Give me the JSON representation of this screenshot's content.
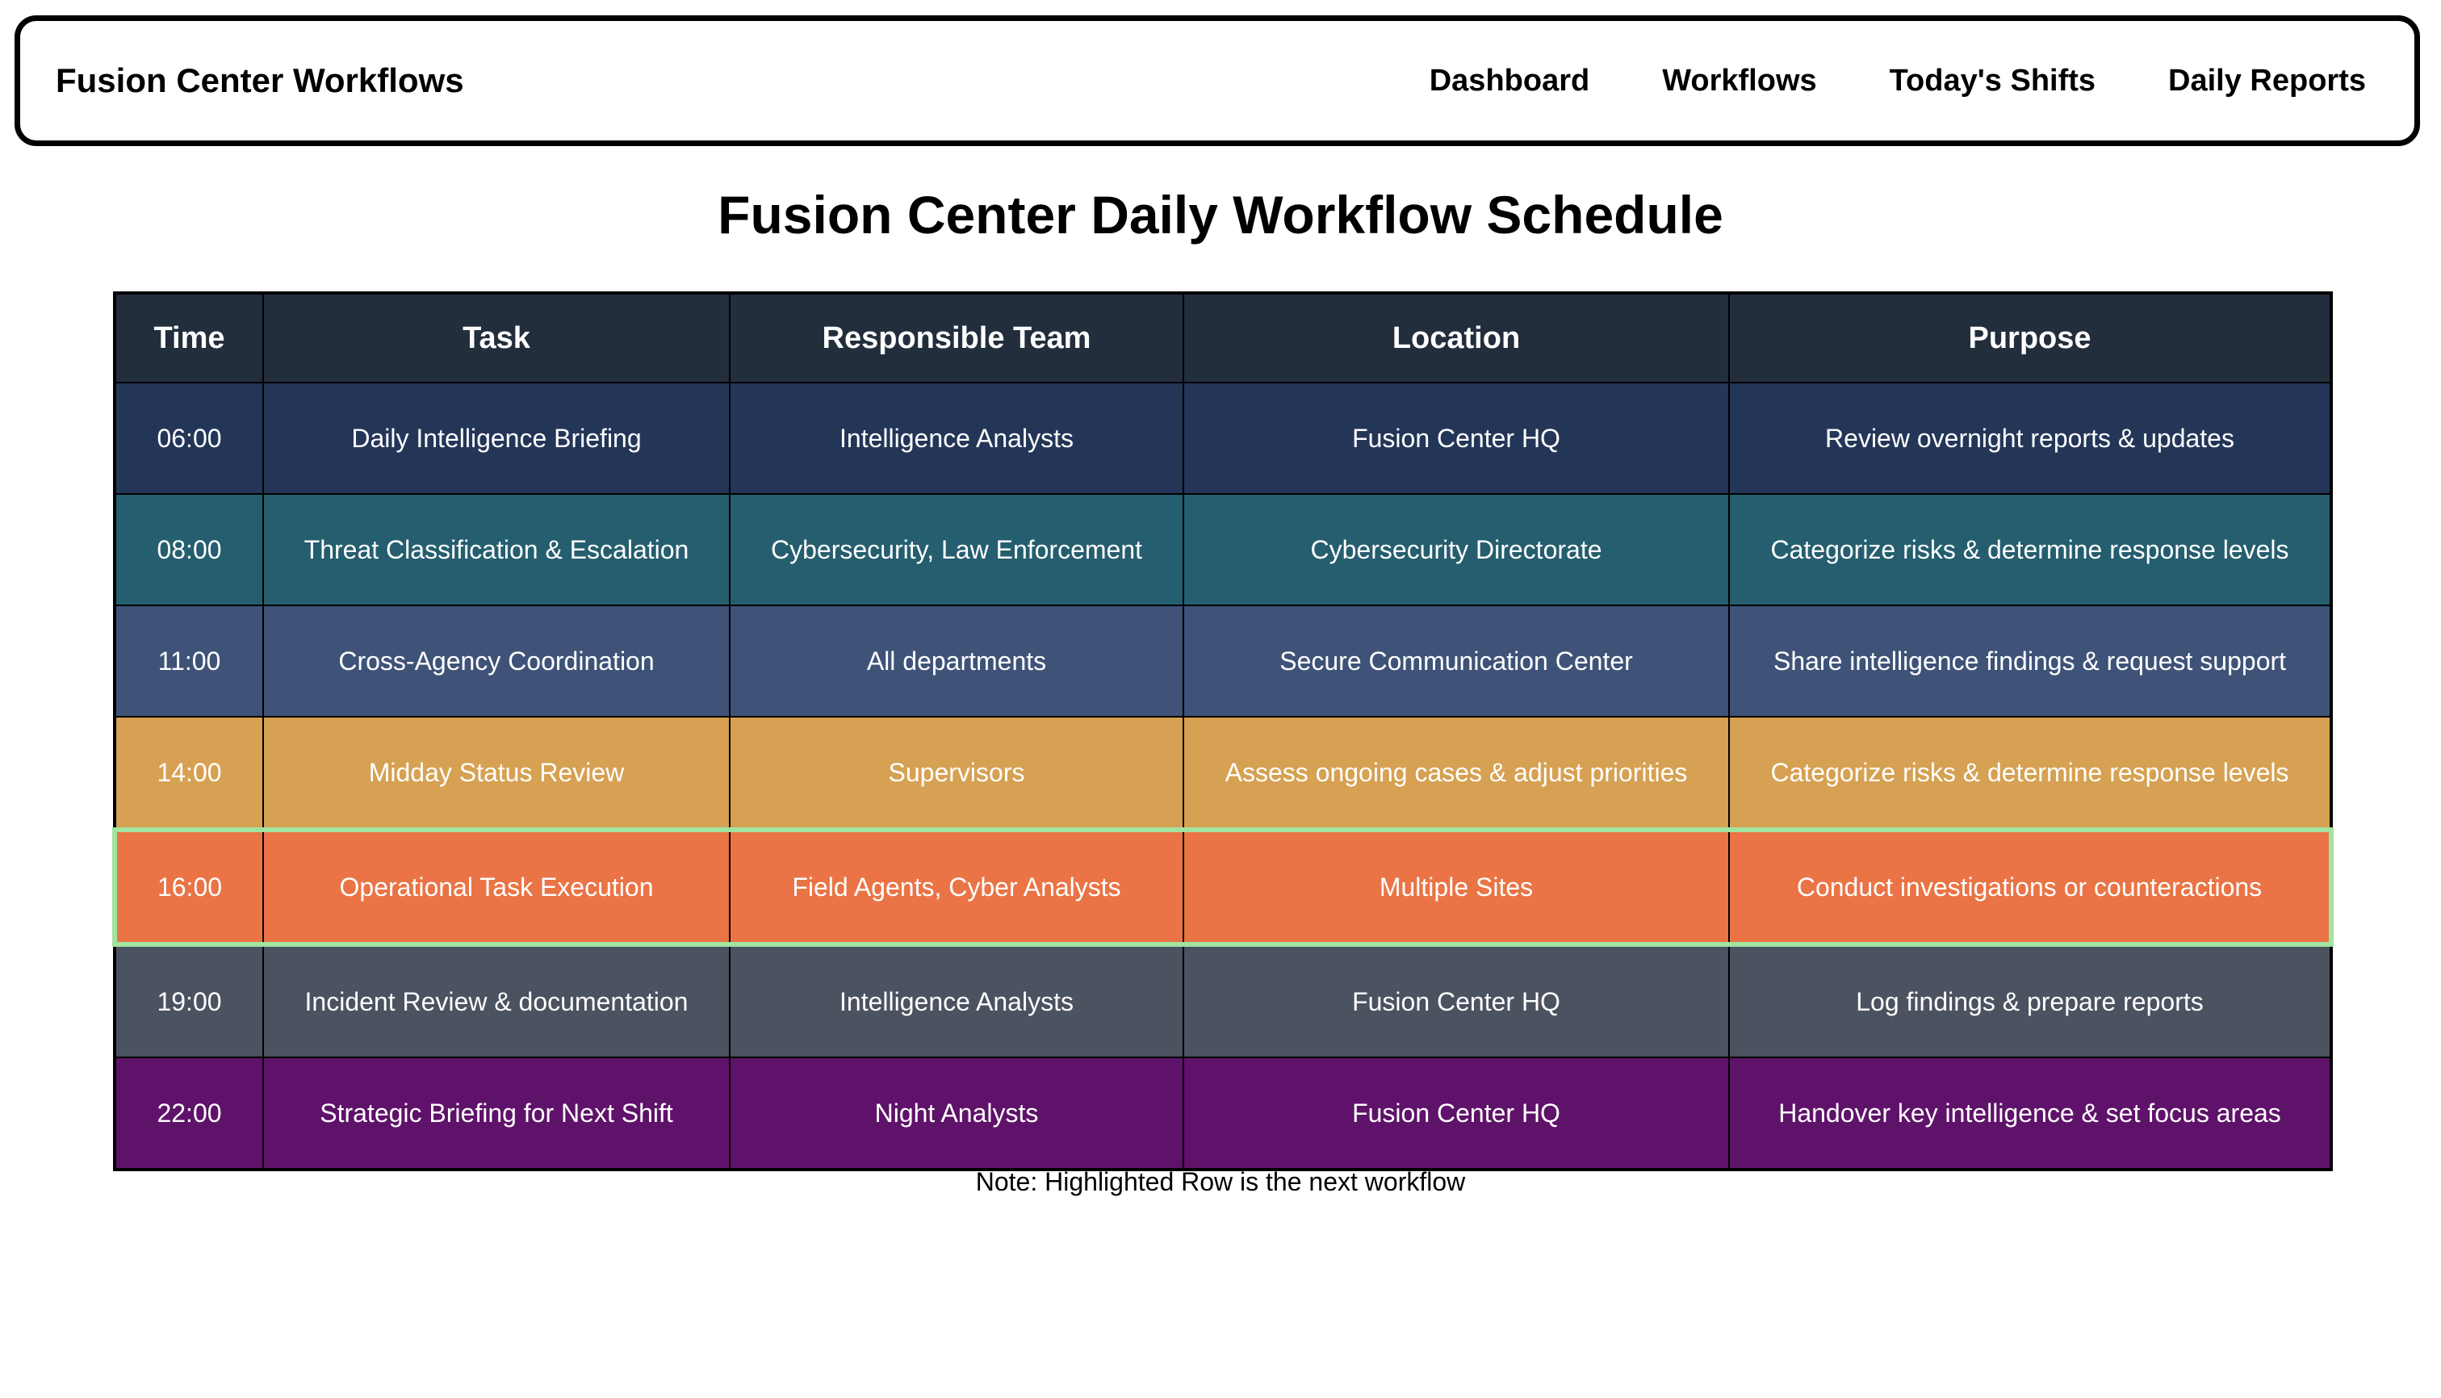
{
  "navbar": {
    "brand": "Fusion Center Workflows",
    "links": [
      "Dashboard",
      "Workflows",
      "Today's Shifts",
      "Daily Reports"
    ]
  },
  "page_title": "Fusion Center Daily Workflow Schedule",
  "table": {
    "headers": [
      "Time",
      "Task",
      "Responsible Team",
      "Location",
      "Purpose"
    ],
    "rows": [
      {
        "time": "06:00",
        "task": "Daily Intelligence Briefing",
        "team": "Intelligence Analysts",
        "location": "Fusion Center HQ",
        "purpose": "Review overnight reports & updates",
        "color": "#243658",
        "highlighted": false
      },
      {
        "time": "08:00",
        "task": "Threat Classification & Escalation",
        "team": "Cybersecurity, Law Enforcement",
        "location": "Cybersecurity Directorate",
        "purpose": "Categorize risks & determine response levels",
        "color": "#255e6f",
        "highlighted": false
      },
      {
        "time": "11:00",
        "task": "Cross-Agency Coordination",
        "team": "All departments",
        "location": "Secure Communication Center",
        "purpose": "Share intelligence findings & request support",
        "color": "#3f5378",
        "highlighted": false
      },
      {
        "time": "14:00",
        "task": "Midday Status Review",
        "team": "Supervisors",
        "location": "Assess ongoing cases & adjust priorities",
        "purpose": "Categorize risks & determine response levels",
        "color": "#d6a152",
        "highlighted": false
      },
      {
        "time": "16:00",
        "task": "Operational Task Execution",
        "team": "Field Agents, Cyber Analysts",
        "location": "Multiple Sites",
        "purpose": "Conduct investigations or counteractions",
        "color": "#ea7445",
        "highlighted": true
      },
      {
        "time": "19:00",
        "task": "Incident Review & documentation",
        "team": "Intelligence Analysts",
        "location": "Fusion Center HQ",
        "purpose": "Log findings & prepare reports",
        "color": "#4b5260",
        "highlighted": false
      },
      {
        "time": "22:00",
        "task": "Strategic Briefing for Next Shift",
        "team": "Night Analysts",
        "location": "Fusion Center HQ",
        "purpose": "Handover key intelligence & set focus areas",
        "color": "#5f1269",
        "highlighted": false
      }
    ],
    "header_color": "#232e3d",
    "highlight_border_color": "#a2e3a0"
  },
  "note": "Note: Highlighted Row is the next workflow"
}
